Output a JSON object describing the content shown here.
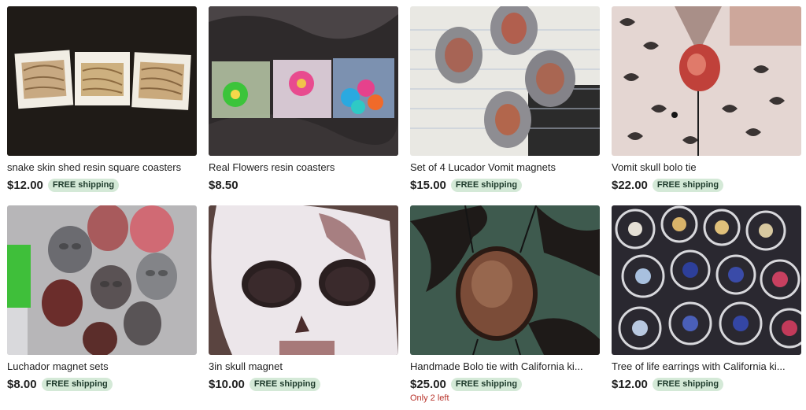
{
  "listings": [
    {
      "title": "snake skin shed resin square coasters",
      "price": "$12.00",
      "shipping": "FREE shipping",
      "stock": ""
    },
    {
      "title": "Real Flowers resin coasters",
      "price": "$8.50",
      "shipping": "",
      "stock": ""
    },
    {
      "title": "Set of 4 Lucador Vomit magnets",
      "price": "$15.00",
      "shipping": "FREE shipping",
      "stock": ""
    },
    {
      "title": "Vomit skull bolo tie",
      "price": "$22.00",
      "shipping": "FREE shipping",
      "stock": ""
    },
    {
      "title": "Luchador magnet sets",
      "price": "$8.00",
      "shipping": "FREE shipping",
      "stock": ""
    },
    {
      "title": "3in skull magnet",
      "price": "$10.00",
      "shipping": "FREE shipping",
      "stock": ""
    },
    {
      "title": "Handmade Bolo tie with California ki...",
      "price": "$25.00",
      "shipping": "FREE shipping",
      "stock": "Only 2 left"
    },
    {
      "title": "Tree of life earrings with California ki...",
      "price": "$12.00",
      "shipping": "FREE shipping",
      "stock": ""
    }
  ],
  "colors": {
    "badge_bg": "#d4e9d7",
    "badge_text": "#1e3b2c",
    "stock_text": "#b8322a",
    "price_text": "#222222"
  }
}
